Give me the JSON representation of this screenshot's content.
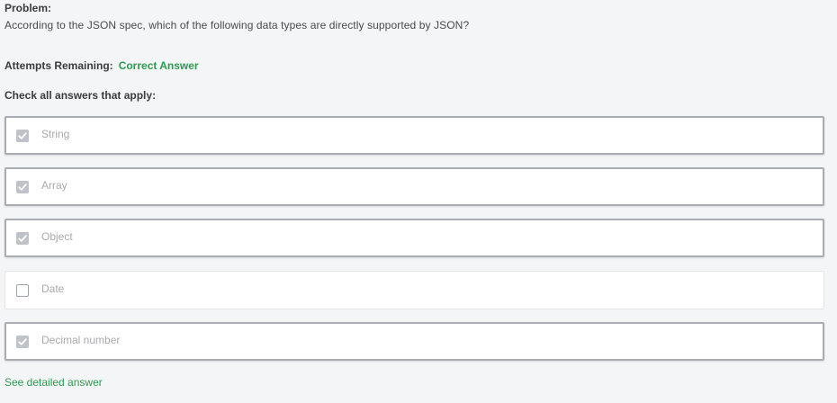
{
  "problem": {
    "heading": "Problem:",
    "question": "According to the JSON spec, which of the following data types are directly supported by JSON?"
  },
  "attempts": {
    "label": "Attempts Remaining:",
    "value": "Correct Answer"
  },
  "instructions": "Check all answers that apply:",
  "options": [
    {
      "label": "String",
      "checked": true
    },
    {
      "label": "Array",
      "checked": true
    },
    {
      "label": "Object",
      "checked": true
    },
    {
      "label": "Date",
      "checked": false
    },
    {
      "label": "Decimal number",
      "checked": true
    }
  ],
  "detail_link": "See detailed answer",
  "colors": {
    "accent_green": "#2e9a4e",
    "checked_border": "#a9adb3",
    "checkbox_fill": "#bfc3c8",
    "background": "#f4f5f7"
  },
  "icons": {
    "checked": "checkmark-icon"
  }
}
